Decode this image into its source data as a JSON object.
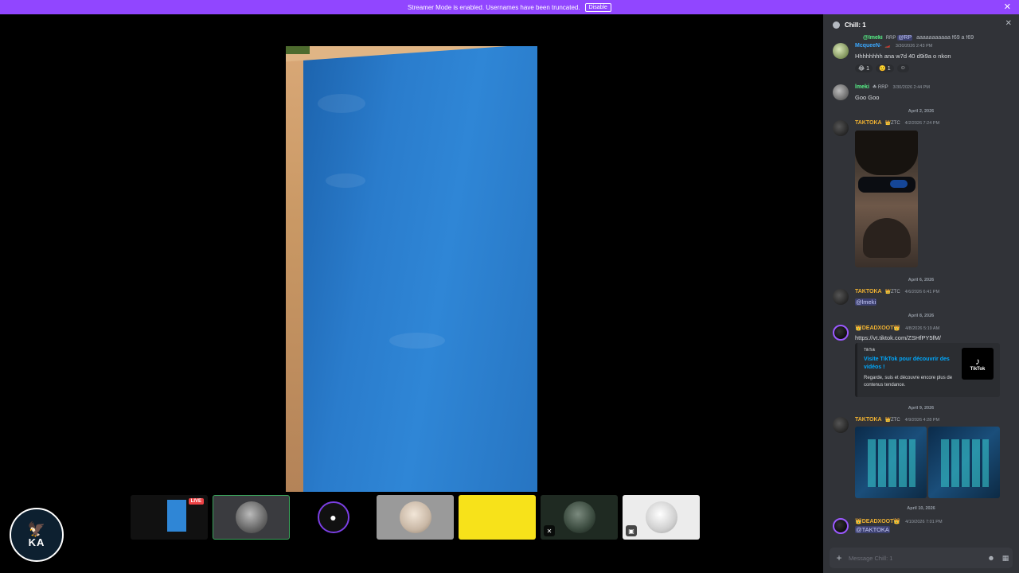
{
  "banner": {
    "text": "Streamer Mode is enabled. Usernames have been truncated.",
    "disable_label": "Disable",
    "close_glyph": "✕"
  },
  "stage": {
    "thumbnails": [
      {
        "kind": "screen",
        "live_label": "LIVE"
      },
      {
        "kind": "avatar",
        "selected": true
      },
      {
        "kind": "camera-icon"
      },
      {
        "kind": "avatar"
      },
      {
        "kind": "yellow"
      },
      {
        "kind": "avatar-muted"
      },
      {
        "kind": "avatar-light"
      }
    ],
    "logo_glyph": "🦅",
    "logo_mark": "KA"
  },
  "chat": {
    "header_title": "Chill: 1",
    "close_glyph": "✕",
    "reply": {
      "name": "@lmeki",
      "tag": "RRP",
      "mention": "@RP",
      "text": "aaaaaaaaaaa f69 a f69"
    },
    "messages": [
      {
        "name": "McqueeN-",
        "name_color": "#3ba8ff",
        "tag": "🏎️",
        "time": "3/30/2026 2:43 PM",
        "text": "Hhhhhhhh ana w7d 40 d9i9a o nkon"
      },
      {
        "name": "lmeki",
        "name_color": "#57f287",
        "tag": "☘ RRP",
        "time": "3/30/2026 2:44 PM",
        "text": "Goo Goo"
      },
      {
        "name": "TAKTOKA",
        "name_color": "#f0b232",
        "tag": "👑ZTC",
        "time": "4/2/2026 7:24 PM"
      },
      {
        "name": "TAKTOKA",
        "name_color": "#f0b232",
        "tag": "👑ZTC",
        "time": "4/6/2026 6:41 PM",
        "mention": "@lmeki"
      },
      {
        "name": "👑DEADXOOT👑",
        "name_color": "#f0b232",
        "time": "4/8/2026 5:19 AM",
        "link": "https://vt.tiktok.com/ZSHfPY5fM/"
      },
      {
        "name": "TAKTOKA",
        "name_color": "#f0b232",
        "tag": "👑ZTC",
        "time": "4/9/2026 4:28 PM"
      },
      {
        "name": "👑DEADXOOT👑",
        "name_color": "#f0b232",
        "time": "4/10/2026 7:01 PM",
        "mention": "@TAKTOKA"
      }
    ],
    "reactions": [
      {
        "emoji": "😂",
        "count": "1"
      },
      {
        "emoji": "🙂",
        "count": "1"
      },
      {
        "emoji": "☺"
      }
    ],
    "dates": [
      "April 2, 2026",
      "April 6, 2026",
      "April 8, 2026",
      "April 9, 2026",
      "April 10, 2026"
    ],
    "embed": {
      "provider": "TikTok",
      "title": "Visite TikTok pour découvrir des vidéos !",
      "description": "Regarde, suis et découvre encore plus de contenus tendance.",
      "thumb_label": "TikTok",
      "thumb_glyph": "♪"
    },
    "composer": {
      "placeholder": "Message Chill: 1",
      "plus_glyph": "+",
      "emoji_glyph": "☻",
      "apps_glyph": "▦"
    }
  },
  "colors": {
    "banner": "#9146ff",
    "chat_bg": "#313338",
    "link": "#00a8fc",
    "selected_border": "#3ba55c"
  }
}
